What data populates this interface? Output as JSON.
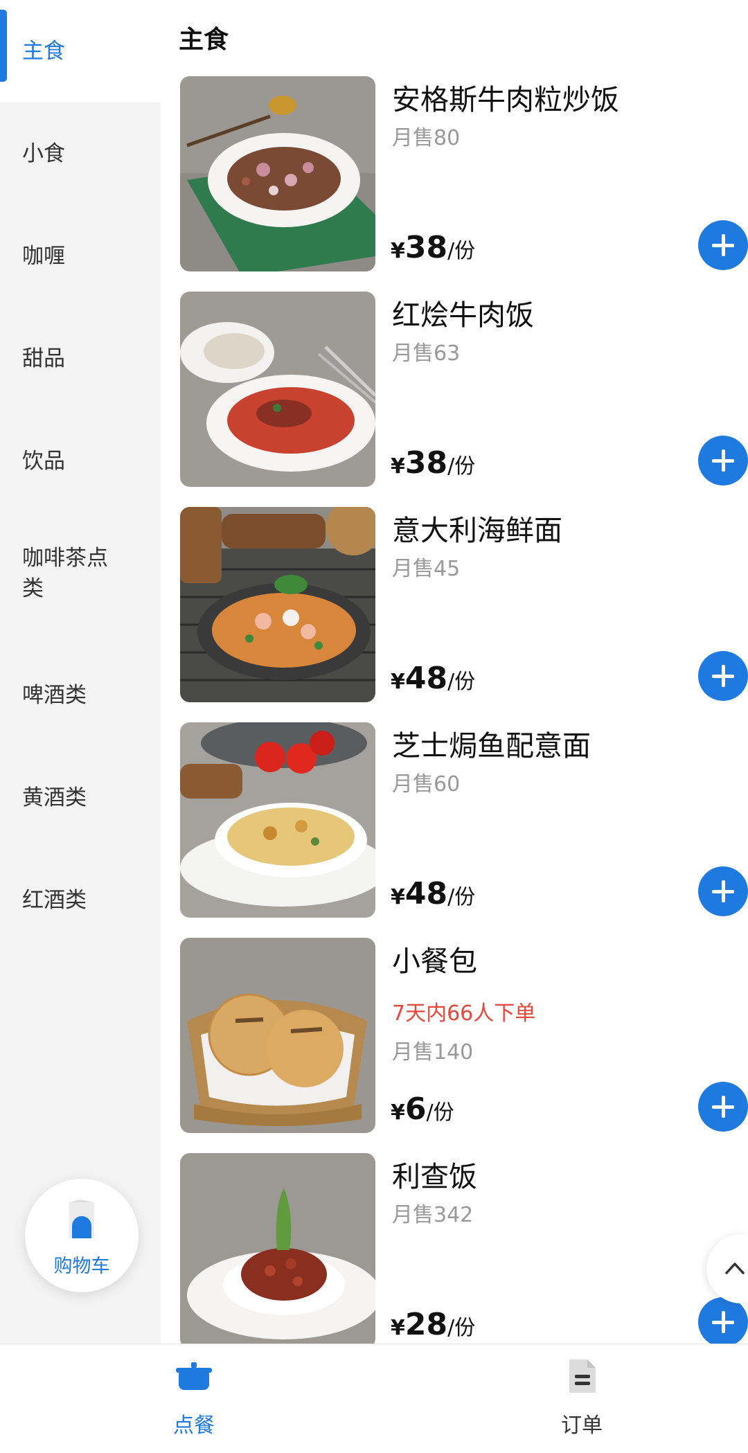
{
  "sidebar": {
    "categories": [
      {
        "label": "主食",
        "active": true
      },
      {
        "label": "小食"
      },
      {
        "label": "咖喱"
      },
      {
        "label": "甜品"
      },
      {
        "label": "饮品"
      },
      {
        "label": "咖啡茶点类"
      },
      {
        "label": "啤酒类"
      },
      {
        "label": "黄酒类"
      },
      {
        "label": "红酒类"
      }
    ],
    "cart_label": "购物车"
  },
  "main": {
    "section_title": "主食",
    "items": [
      {
        "name": "安格斯牛肉粒炒饭",
        "sales": "月售80",
        "currency": "¥",
        "price": "38",
        "unit": "/份"
      },
      {
        "name": "红烩牛肉饭",
        "sales": "月售63",
        "currency": "¥",
        "price": "38",
        "unit": "/份"
      },
      {
        "name": "意大利海鲜面",
        "sales": "月售45",
        "currency": "¥",
        "price": "48",
        "unit": "/份"
      },
      {
        "name": "芝士焗鱼配意面",
        "sales": "月售60",
        "currency": "¥",
        "price": "48",
        "unit": "/份"
      },
      {
        "name": "小餐包",
        "promo": "7天内66人下单",
        "sales": "月售140",
        "currency": "¥",
        "price": "6",
        "unit": "/份"
      },
      {
        "name": "利查饭",
        "sales": "月售342",
        "currency": "¥",
        "price": "28",
        "unit": "/份"
      }
    ]
  },
  "tabbar": {
    "tabs": [
      {
        "label": "点餐",
        "icon": "pot-icon",
        "active": true
      },
      {
        "label": "订单",
        "icon": "document-icon"
      }
    ]
  },
  "colors": {
    "accent": "#1f7ae0",
    "promo": "#e8483a",
    "muted": "#999999",
    "sidebar_bg": "#f4f4f4"
  }
}
